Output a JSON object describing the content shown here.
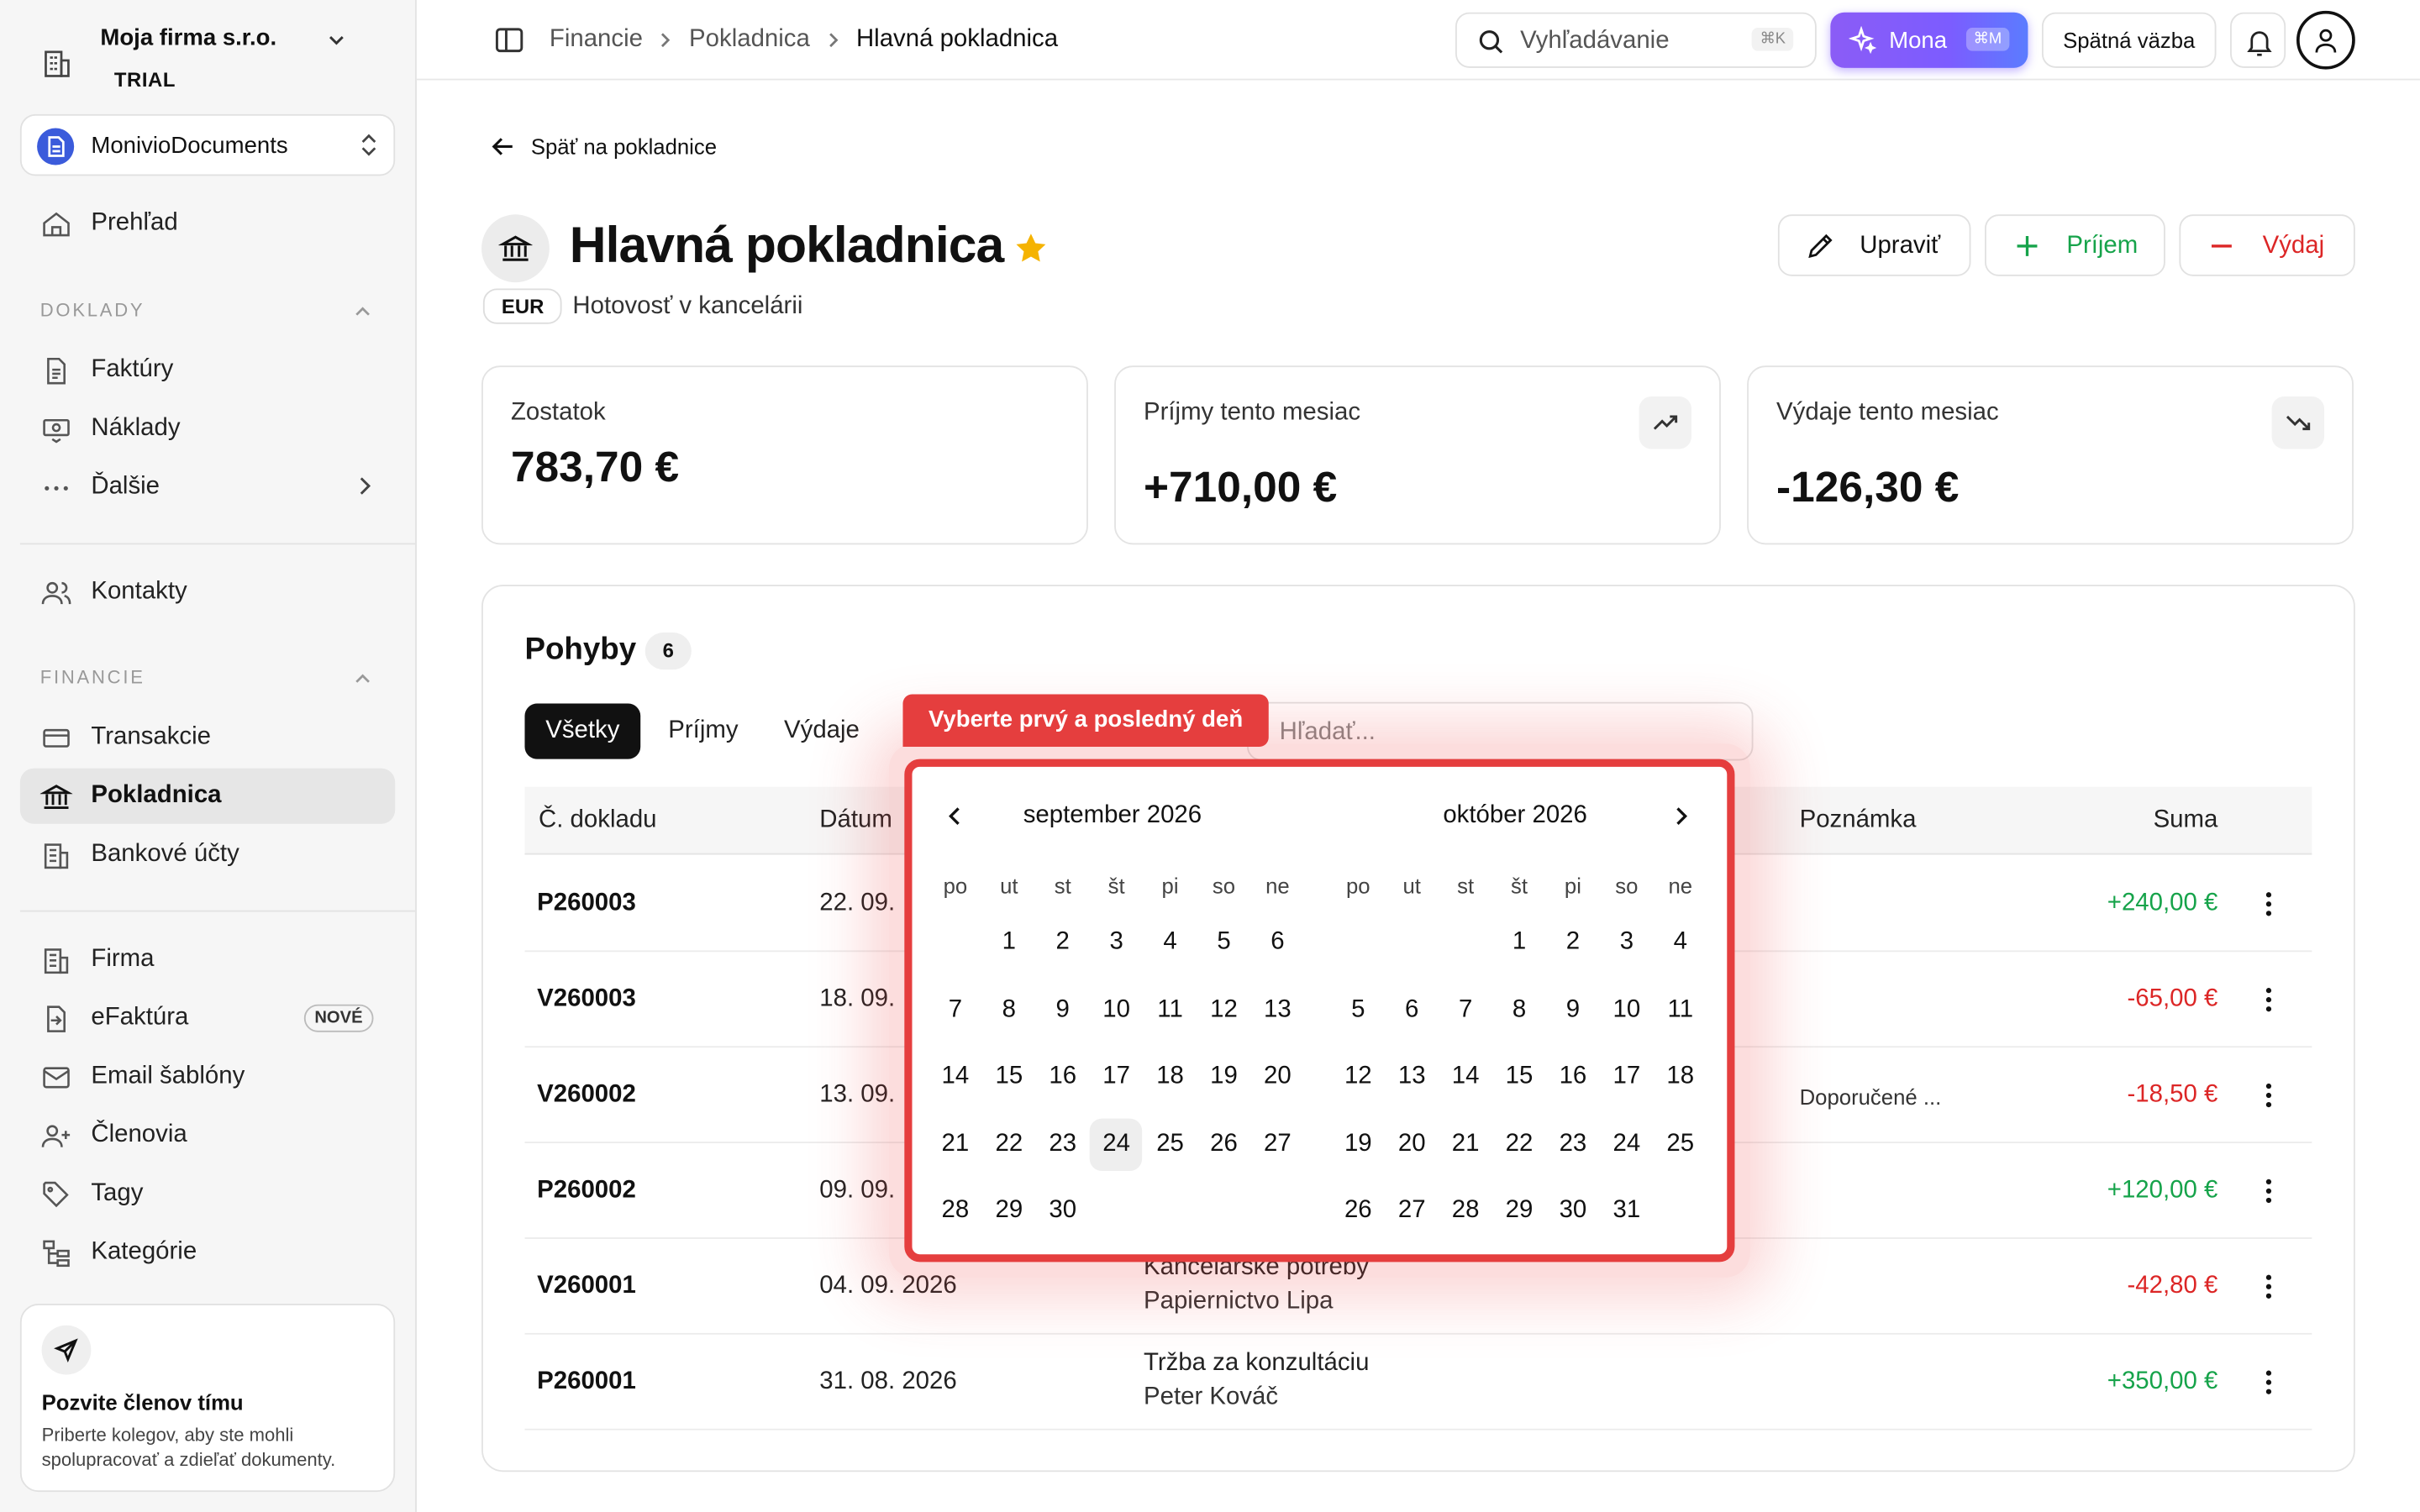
{
  "org": {
    "name": "Moja firma s.r.o.",
    "plan": "TRIAL"
  },
  "workspace": {
    "name": "MonivioDocuments"
  },
  "sidebar": {
    "overview": "Prehľad",
    "section_docs": "DOKLADY",
    "invoices": "Faktúry",
    "expenses": "Náklady",
    "more": "Ďalšie",
    "contacts": "Kontakty",
    "section_finance": "FINANCIE",
    "transactions": "Transakcie",
    "cashbox": "Pokladnica",
    "bank_accounts": "Bankové účty",
    "company": "Firma",
    "einvoice": "eFaktúra",
    "einvoice_badge": "NOVÉ",
    "email_templates": "Email šablóny",
    "members": "Členovia",
    "tags": "Tagy",
    "categories": "Kategórie"
  },
  "invite": {
    "title": "Pozvite členov tímu",
    "desc": "Priberte kolegov, aby ste mohli spolupracovať a zdieľať dokumenty."
  },
  "breadcrumb": [
    "Financie",
    "Pokladnica",
    "Hlavná pokladnica"
  ],
  "topbar": {
    "search_placeholder": "Vyhľadávanie",
    "search_shortcut": "⌘K",
    "mona_label": "Mona",
    "mona_shortcut": "⌘M",
    "feedback_label": "Spätná väzba"
  },
  "page": {
    "back_label": "Späť na pokladnice",
    "title": "Hlavná pokladnica",
    "currency": "EUR",
    "subtitle": "Hotovosť v kancelárii",
    "edit_label": "Upraviť",
    "income_label": "Príjem",
    "expense_label": "Výdaj"
  },
  "stats": {
    "balance_label": "Zostatok",
    "balance_value": "783,70 €",
    "income_label": "Príjmy tento mesiac",
    "income_value": "+710,00 €",
    "expense_label": "Výdaje tento mesiac",
    "expense_value": "-126,30 €"
  },
  "movements": {
    "title": "Pohyby",
    "count": "6",
    "tabs": [
      "Všetky",
      "Príjmy",
      "Výdaje"
    ],
    "search_placeholder": "Hľadať...",
    "columns": {
      "doc": "Č. dokladu",
      "date": "Dátum",
      "note": "Poznámka",
      "amount": "Suma"
    },
    "rows": [
      {
        "doc": "P260003",
        "date": "22. 09.",
        "desc": "",
        "party": "",
        "note": "",
        "amount": "+240,00 €",
        "sign": "pos"
      },
      {
        "doc": "V260003",
        "date": "18. 09.",
        "desc": "",
        "party": "",
        "note": "",
        "amount": "-65,00 €",
        "sign": "neg"
      },
      {
        "doc": "V260002",
        "date": "13. 09.",
        "desc": "",
        "party": "",
        "note": "Doporučené ...",
        "amount": "-18,50 €",
        "sign": "neg"
      },
      {
        "doc": "P260002",
        "date": "09. 09.",
        "desc": "",
        "party": "",
        "note": "",
        "amount": "+120,00 €",
        "sign": "pos"
      },
      {
        "doc": "V260001",
        "date": "04. 09. 2026",
        "desc": "Kancelárske potreby",
        "party": "Papiernictvo Lipa",
        "note": "",
        "amount": "-42,80 €",
        "sign": "neg"
      },
      {
        "doc": "P260001",
        "date": "31. 08. 2026",
        "desc": "Tržba za konzultáciu",
        "party": "Peter Kováč",
        "note": "",
        "amount": "+350,00 €",
        "sign": "pos"
      }
    ]
  },
  "datepicker": {
    "hint": "Vyberte prvý a posledný deň",
    "weekdays": [
      "po",
      "ut",
      "st",
      "št",
      "pi",
      "so",
      "ne"
    ],
    "months": [
      {
        "title": "september 2026",
        "offset": 1,
        "days": 30,
        "today": 24
      },
      {
        "title": "október 2026",
        "offset": 3,
        "days": 31,
        "today": null
      }
    ]
  },
  "colors": {
    "accent": "#7c5cff",
    "positive": "#16a34a",
    "negative": "#dc2626",
    "highlight": "#e53e3e",
    "star": "#f5b301"
  }
}
